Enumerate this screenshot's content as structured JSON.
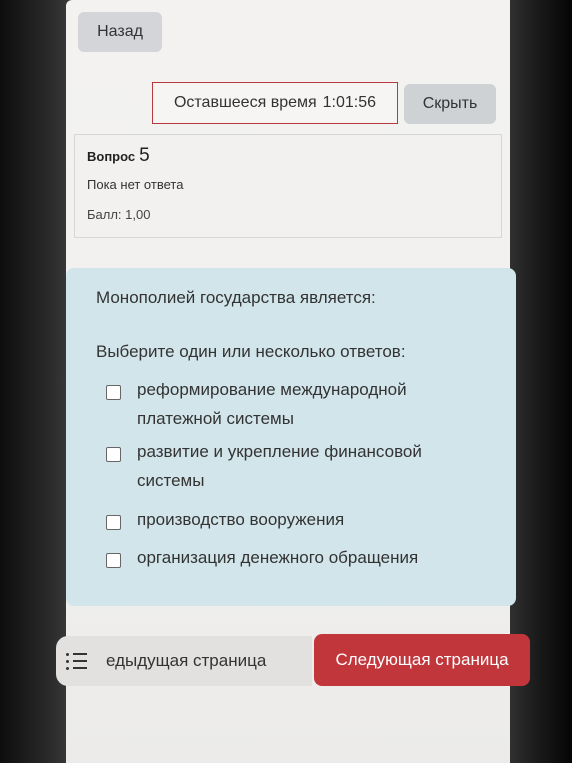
{
  "nav": {
    "back_label": "Назад"
  },
  "timer": {
    "label": "Оставшееся время",
    "value": "1:01:56",
    "hide_label": "Скрыть"
  },
  "question_info": {
    "title_prefix": "Вопрос",
    "number": "5",
    "status": "Пока нет ответа",
    "score": "Балл: 1,00"
  },
  "question": {
    "text": "Монополией государства является:",
    "prompt": "Выберите один или несколько ответов:",
    "options": [
      {
        "label_lines": [
          "реформирование международной",
          "платежной системы"
        ],
        "checked": false
      },
      {
        "label_lines": [
          "развитие и укрепление финансовой",
          "системы"
        ],
        "checked": false
      },
      {
        "label_lines": [
          "производство вооружения"
        ],
        "checked": false
      },
      {
        "label_lines": [
          "организация денежного обращения"
        ],
        "checked": false
      }
    ]
  },
  "footer": {
    "list_icon": "list-icon",
    "prev_label": "едыдущая страница",
    "next_label": "Следующая страница"
  },
  "colors": {
    "accent": "#c0363b",
    "question_card": "#d1e5ea",
    "button_grey": "#d3d5d8"
  }
}
